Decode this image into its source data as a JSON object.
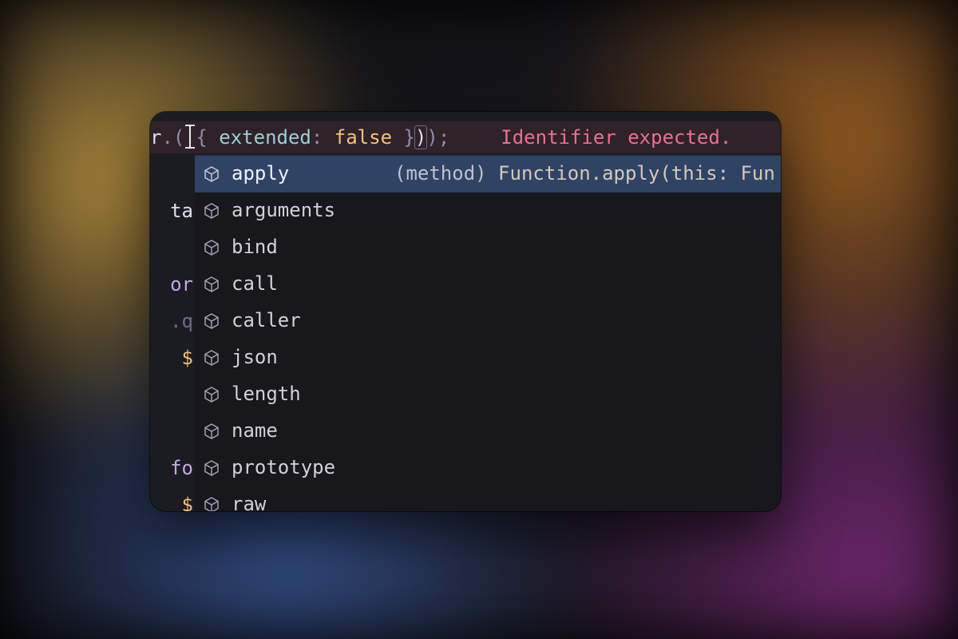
{
  "editor": {
    "code_line": {
      "prefix_var": "r",
      "dot1": ".",
      "open_paren": "(",
      "cursor_placeholder": "",
      "open_brace": "{ ",
      "prop_key": "extended",
      "colon": ": ",
      "prop_val": "false",
      "close_brace": " }",
      "close_paren1": ")",
      "close_paren2": ")",
      "semicolon": ";",
      "error_message": "Identifier expected."
    },
    "gutter_fragments": [
      {
        "text": "",
        "cls": ""
      },
      {
        "text": "ta",
        "cls": "tk-var"
      },
      {
        "text": "",
        "cls": ""
      },
      {
        "text": "or",
        "cls": "tk-keyword"
      },
      {
        "text": ".q",
        "cls": "tk-grey"
      },
      {
        "text": " $",
        "cls": "tk-dollar"
      },
      {
        "text": "",
        "cls": ""
      },
      {
        "text": "",
        "cls": ""
      },
      {
        "text": "fo",
        "cls": "tk-keyword"
      },
      {
        "text": " $",
        "cls": "tk-dollar"
      }
    ]
  },
  "autocomplete": {
    "selected_index": 0,
    "items": [
      {
        "label": "apply",
        "detail_kind": "(method)",
        "detail_sig": " Function.apply(this: Fun"
      },
      {
        "label": "arguments"
      },
      {
        "label": "bind"
      },
      {
        "label": "call"
      },
      {
        "label": "caller"
      },
      {
        "label": "json"
      },
      {
        "label": "length"
      },
      {
        "label": "name"
      },
      {
        "label": "prototype"
      },
      {
        "label": "raw"
      }
    ]
  },
  "colors": {
    "panel_bg": "#1b1c21",
    "popup_bg": "#17171c",
    "selection_bg": "#2f4365",
    "error_fg": "#eb6f92",
    "key_fg": "#9ccfd8",
    "bool_fg": "#f6c177",
    "label_fg": "#cfd1db",
    "icon_stroke": "#a0a1b0"
  }
}
